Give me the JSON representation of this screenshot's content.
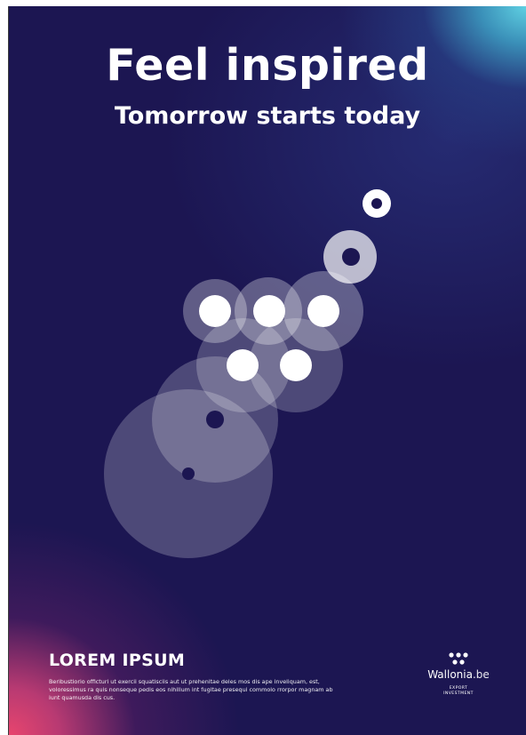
{
  "poster": {
    "headline": "Feel inspired",
    "subheadline": "Tomorrow starts today",
    "footer_title": "LOREM IPSUM",
    "footer_body": "Beribustiorio officturi ut exercii squatisciis aut ut prehenitae deles mos dis ape inveliquam, est, voloressimus ra quis nonseque pedis eos nihillum int fugitae presequi commolo rrorpor magnam ab iunt quamusda dis cus."
  },
  "brand": {
    "name": "Wallonia",
    "tld": ".be",
    "tagline_line1": "EXPORT",
    "tagline_line2": "INVESTMENT",
    "logo_icon": "five-dots-logo-icon"
  },
  "colors": {
    "background": "#1c1652",
    "accent_cyan": "#5fd0e2",
    "accent_pink": "#e8456e",
    "circle_fill": "#ffffff",
    "text": "#ffffff"
  }
}
